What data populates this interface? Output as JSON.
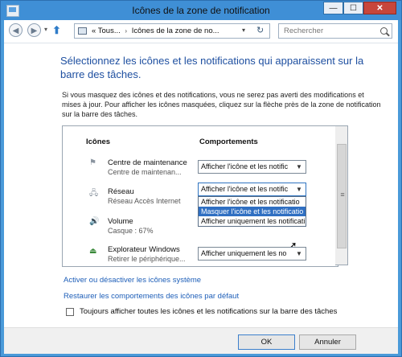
{
  "window": {
    "title": "Icônes de la zone de notification",
    "controls": {
      "minimize": "—",
      "maximize": "☐",
      "close": "✕"
    }
  },
  "nav": {
    "back_icon": "◀",
    "forward_icon": "▶",
    "dropdown_icon": "▾",
    "up_icon": "⬆",
    "breadcrumb_prefix": "«",
    "breadcrumb": [
      "Tous...",
      "Icônes de la zone de no..."
    ],
    "breadcrumb_separator": "›",
    "address_dropdown_icon": "▾",
    "refresh_icon": "↻",
    "search_placeholder": "Rechercher"
  },
  "main": {
    "heading": "Sélectionnez les icônes et les notifications qui apparaissent sur la barre des tâches.",
    "description": "Si vous masquez des icônes et des notifications, vous ne serez pas averti des modifications et mises à jour. Pour afficher les icônes masquées, cliquez sur la flèche près de la zone de notification sur la barre des tâches."
  },
  "table": {
    "col_icons": "Icônes",
    "col_behaviors": "Comportements",
    "rows": [
      {
        "icon": "flag-icon",
        "glyph": "⚑",
        "name": "Centre de maintenance",
        "subtitle": "Centre de maintenan...",
        "behavior": "Afficher l'icône et les notific"
      },
      {
        "icon": "network-icon",
        "glyph": "🖧",
        "name": "Réseau",
        "subtitle": "Réseau Accès Internet",
        "behavior": "Afficher l'icône et les notific"
      },
      {
        "icon": "volume-icon",
        "glyph": "🔊",
        "name": "Volume",
        "subtitle": "Casque : 67%",
        "behavior": ""
      },
      {
        "icon": "usb-eject-icon",
        "glyph": "⏏",
        "name": "Explorateur Windows",
        "subtitle": "Retirer le périphérique...",
        "behavior": "Afficher uniquement les no"
      }
    ],
    "dropdown_options": [
      "Afficher l'icône et les notificatio",
      "Masquer l'icône et les notificatio",
      "Afficher uniquement les notificati"
    ],
    "dropdown_selected_index": 1
  },
  "links": {
    "system_icons": "Activer ou désactiver les icônes système",
    "restore": "Restaurer les comportements des icônes par défaut"
  },
  "checkbox": {
    "label": "Toujours afficher toutes les icônes et les notifications sur la barre des tâches",
    "checked": false
  },
  "buttons": {
    "ok": "OK",
    "cancel": "Annuler"
  },
  "colors": {
    "accent": "#3f8fd6",
    "heading": "#1e4fa0",
    "link": "#1d5eb8",
    "highlight": "#2f6fc2"
  }
}
